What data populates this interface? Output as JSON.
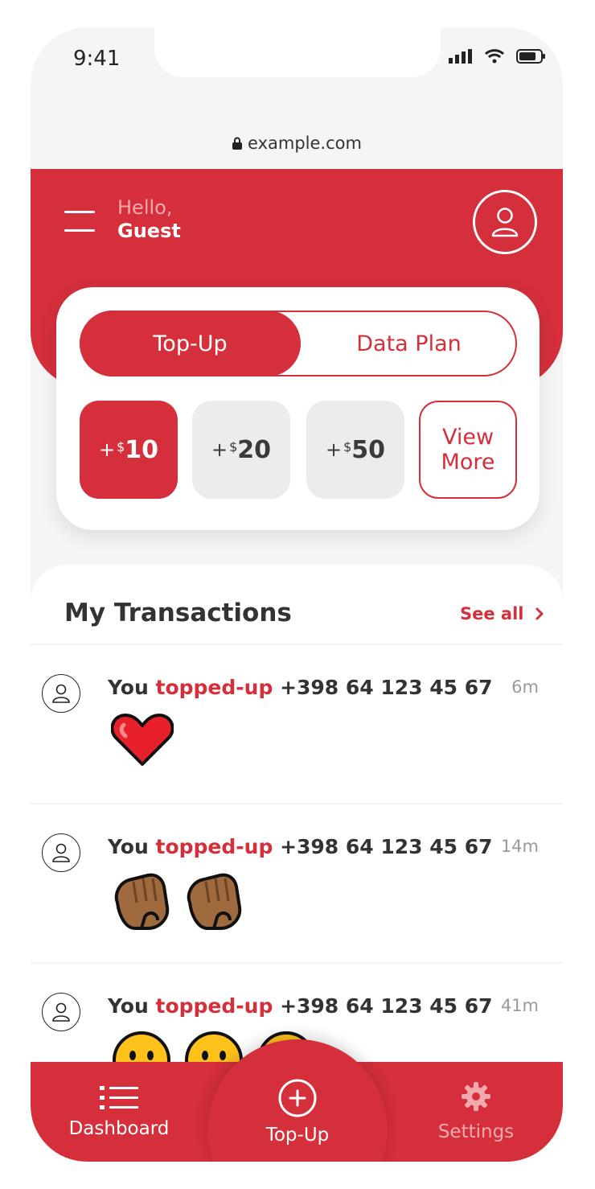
{
  "status_bar": {
    "time": "9:41"
  },
  "browser": {
    "url": "example.com"
  },
  "header": {
    "greeting": "Hello,",
    "user_name": "Guest"
  },
  "tabs": {
    "active": "Top-Up",
    "inactive": "Data Plan"
  },
  "amounts": [
    {
      "plus": "+",
      "currency": "$",
      "value": "10",
      "selected": true
    },
    {
      "plus": "+",
      "currency": "$",
      "value": "20",
      "selected": false
    },
    {
      "plus": "+",
      "currency": "$",
      "value": "50",
      "selected": false
    }
  ],
  "view_more": {
    "line1": "View",
    "line2": "More"
  },
  "transactions": {
    "title": "My Transactions",
    "see_all": "See all",
    "items": [
      {
        "subject": "You",
        "verb": "topped-up",
        "number": "+398 64 123 45 67",
        "time": "6m",
        "reaction": "red-heart"
      },
      {
        "subject": "You",
        "verb": "topped-up",
        "number": "+398 64 123 45 67",
        "time": "14m",
        "reaction": "clapping-hands"
      },
      {
        "subject": "You",
        "verb": "topped-up",
        "number": "+398 64 123 45 67",
        "time": "41m",
        "reaction": "neutral-faces"
      }
    ]
  },
  "nav": {
    "dashboard": "Dashboard",
    "topup": "Top-Up",
    "settings": "Settings"
  },
  "colors": {
    "accent": "#d42f3b",
    "muted": "#ececec"
  }
}
